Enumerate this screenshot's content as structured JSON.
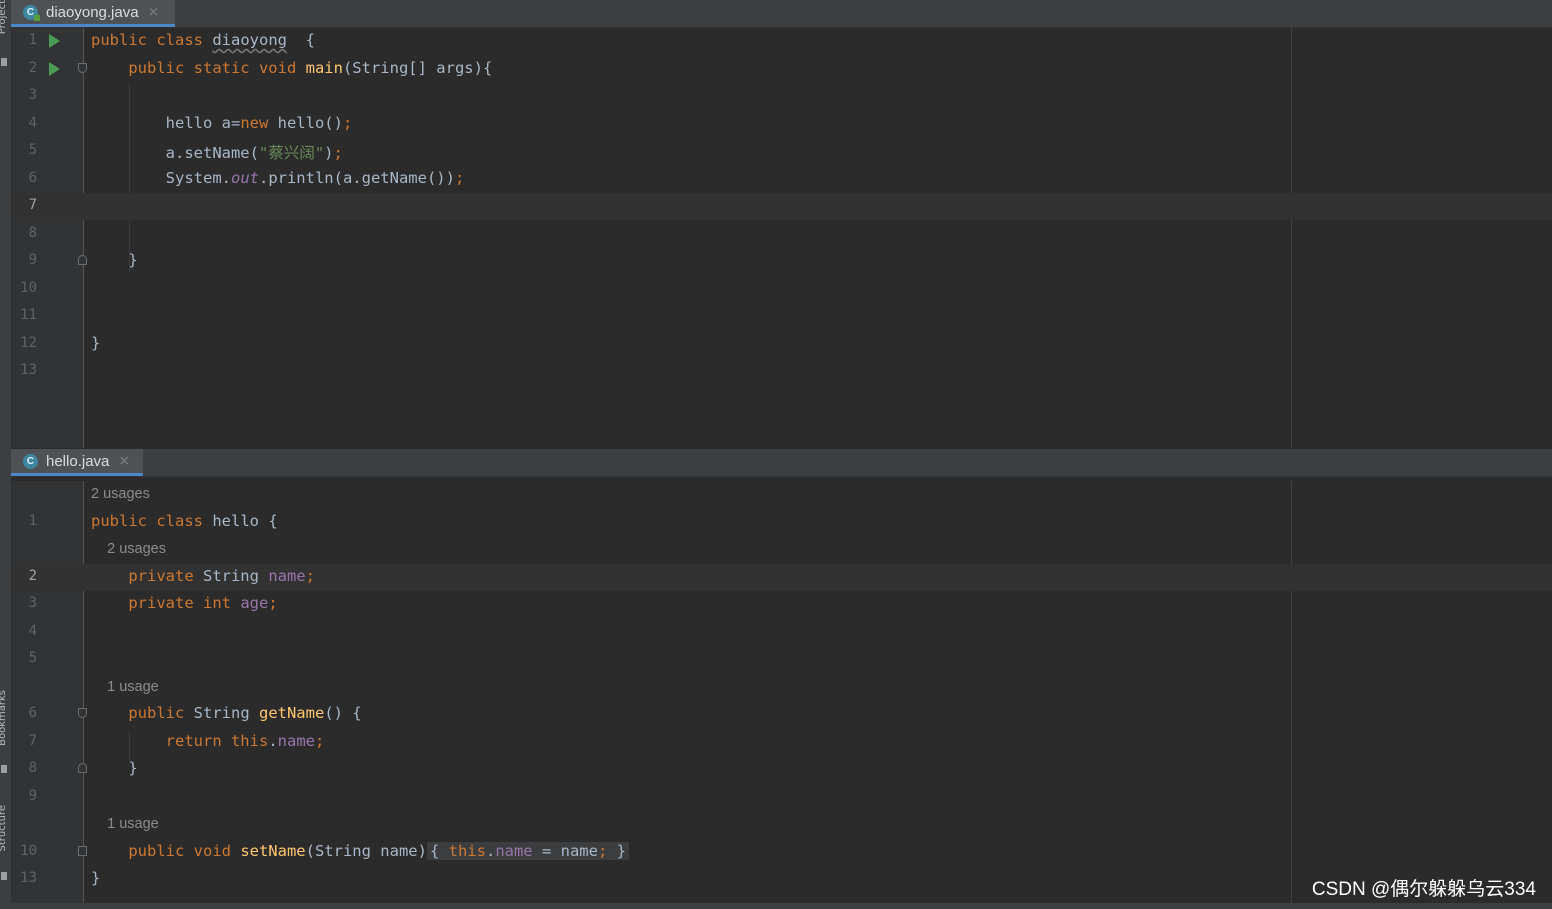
{
  "side": {
    "project_label": "Project",
    "bookmarks_label": "Bookmarks",
    "structure_label": "Structure"
  },
  "pane1": {
    "tab": {
      "icon": "C",
      "label": "diaoyong.java",
      "close": "×"
    },
    "lines": [
      {
        "n": "1",
        "run": true,
        "tokens": [
          [
            "kw",
            "public class "
          ],
          [
            "squig",
            "diaoyong"
          ],
          [
            "",
            "  {"
          ]
        ]
      },
      {
        "n": "2",
        "run": true,
        "fold": "start",
        "tokens": [
          [
            "",
            "    "
          ],
          [
            "kw",
            "public static void "
          ],
          [
            "fn",
            "main"
          ],
          [
            "",
            "(String[] args){"
          ]
        ]
      },
      {
        "n": "3",
        "tokens": []
      },
      {
        "n": "4",
        "tokens": [
          [
            "",
            "        hello a="
          ],
          [
            "kw",
            "new "
          ],
          [
            "",
            "hello()"
          ],
          [
            "kw",
            ";"
          ]
        ]
      },
      {
        "n": "5",
        "tokens": [
          [
            "",
            "        a.setName("
          ],
          [
            "str",
            "\"蔡兴阔\""
          ],
          [
            "",
            ")"
          ],
          [
            "kw",
            ";"
          ]
        ]
      },
      {
        "n": "6",
        "tokens": [
          [
            "",
            "        System."
          ],
          [
            "static",
            "out"
          ],
          [
            "",
            ".println(a.getName())"
          ],
          [
            "kw",
            ";"
          ]
        ]
      },
      {
        "n": "7",
        "current": true,
        "tokens": []
      },
      {
        "n": "8",
        "tokens": []
      },
      {
        "n": "9",
        "fold": "end",
        "tokens": [
          [
            "",
            "    }"
          ]
        ]
      },
      {
        "n": "10",
        "tokens": []
      },
      {
        "n": "11",
        "tokens": []
      },
      {
        "n": "12",
        "tokens": [
          [
            "",
            "}"
          ]
        ]
      },
      {
        "n": "13",
        "tokens": []
      }
    ]
  },
  "pane2": {
    "tab": {
      "icon": "C",
      "label": "hello.java",
      "close": "×"
    },
    "lines": [
      {
        "hint": "2 usages"
      },
      {
        "n": "1",
        "tokens": [
          [
            "kw",
            "public class "
          ],
          [
            "",
            "hello {"
          ]
        ]
      },
      {
        "hint": "    2 usages"
      },
      {
        "n": "2",
        "current": true,
        "tokens": [
          [
            "",
            "    "
          ],
          [
            "kw",
            "private "
          ],
          [
            "",
            "String "
          ],
          [
            "field",
            "name"
          ],
          [
            "kw",
            ";"
          ]
        ]
      },
      {
        "n": "3",
        "tokens": [
          [
            "",
            "    "
          ],
          [
            "kw",
            "private int "
          ],
          [
            "field",
            "age"
          ],
          [
            "kw",
            ";"
          ]
        ]
      },
      {
        "n": "4",
        "tokens": []
      },
      {
        "n": "5",
        "tokens": []
      },
      {
        "hint": "    1 usage"
      },
      {
        "n": "6",
        "fold": "start",
        "tokens": [
          [
            "",
            "    "
          ],
          [
            "kw",
            "public "
          ],
          [
            "",
            "String "
          ],
          [
            "fn",
            "getName"
          ],
          [
            "",
            "() {"
          ]
        ]
      },
      {
        "n": "7",
        "tokens": [
          [
            "",
            "        "
          ],
          [
            "kw",
            "return this"
          ],
          [
            "",
            "."
          ],
          [
            "field",
            "name"
          ],
          [
            "kw",
            ";"
          ]
        ]
      },
      {
        "n": "8",
        "fold": "end",
        "tokens": [
          [
            "",
            "    }"
          ]
        ]
      },
      {
        "n": "9",
        "tokens": []
      },
      {
        "hint": "    1 usage"
      },
      {
        "n": "10",
        "fold": "box",
        "tokens": [
          [
            "",
            "    "
          ],
          [
            "kw",
            "public void "
          ],
          [
            "fn",
            "setName"
          ],
          [
            "",
            "(String name)"
          ],
          [
            "region",
            "{ this.name = name; }"
          ]
        ]
      },
      {
        "n": "13",
        "tokens": [
          [
            "",
            "}"
          ]
        ]
      }
    ]
  },
  "watermark": "CSDN @偶尔躲躲乌云334"
}
